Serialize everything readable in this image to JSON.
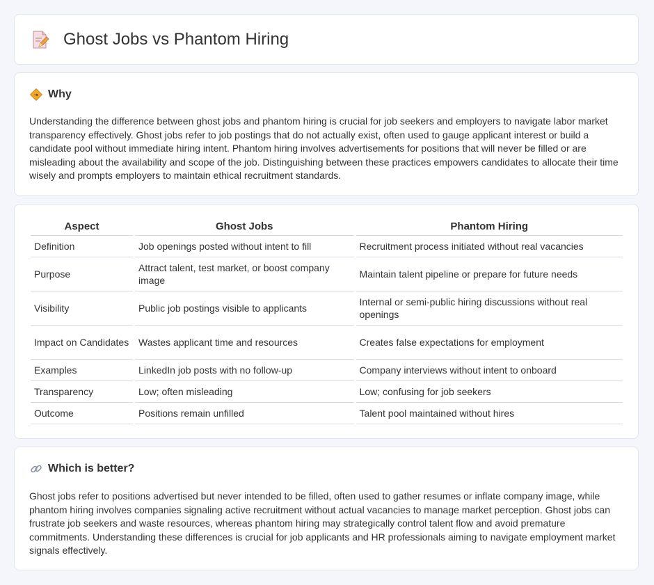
{
  "header": {
    "title": "Ghost Jobs vs Phantom Hiring",
    "icon": "document-pencil-icon"
  },
  "why": {
    "icon": "diamond-sign-icon",
    "heading": "Why",
    "text": "Understanding the difference between ghost jobs and phantom hiring is crucial for job seekers and employers to navigate labor market transparency effectively. Ghost jobs refer to job postings that do not actually exist, often used to gauge applicant interest or build a candidate pool without immediate hiring intent. Phantom hiring involves advertisements for positions that will never be filled or are misleading about the availability and scope of the job. Distinguishing between these practices empowers candidates to allocate their time wisely and prompts employers to maintain ethical recruitment standards."
  },
  "comparison": {
    "headers": [
      "Aspect",
      "Ghost Jobs",
      "Phantom Hiring"
    ],
    "rows": [
      [
        "Definition",
        "Job openings posted without intent to fill",
        "Recruitment process initiated without real vacancies"
      ],
      [
        "Purpose",
        "Attract talent, test market, or boost company image",
        "Maintain talent pipeline or prepare for future needs"
      ],
      [
        "Visibility",
        "Public job postings visible to applicants",
        "Internal or semi-public hiring discussions without real openings"
      ],
      [
        "Impact on Candidates",
        "Wastes applicant time and resources",
        "Creates false expectations for employment"
      ],
      [
        "Examples",
        "LinkedIn job posts with no follow-up",
        "Company interviews without intent to onboard"
      ],
      [
        "Transparency",
        "Low; often misleading",
        "Low; confusing for job seekers"
      ],
      [
        "Outcome",
        "Positions remain unfilled",
        "Talent pool maintained without hires"
      ]
    ]
  },
  "better": {
    "icon": "link-icon",
    "heading": "Which is better?",
    "text": "Ghost jobs refer to positions advertised but never intended to be filled, often used to gather resumes or inflate company image, while phantom hiring involves companies signaling active recruitment without actual vacancies to manage market perception. Ghost jobs can frustrate job seekers and waste resources, whereas phantom hiring may strategically control talent flow and avoid premature commitments. Understanding these differences is crucial for job applicants and HR professionals aiming to navigate employment market signals effectively."
  },
  "colors": {
    "background": "#f4f6fb",
    "card_border": "#e1e5ee",
    "text": "#333333",
    "accent_orange": "#f5a623"
  }
}
